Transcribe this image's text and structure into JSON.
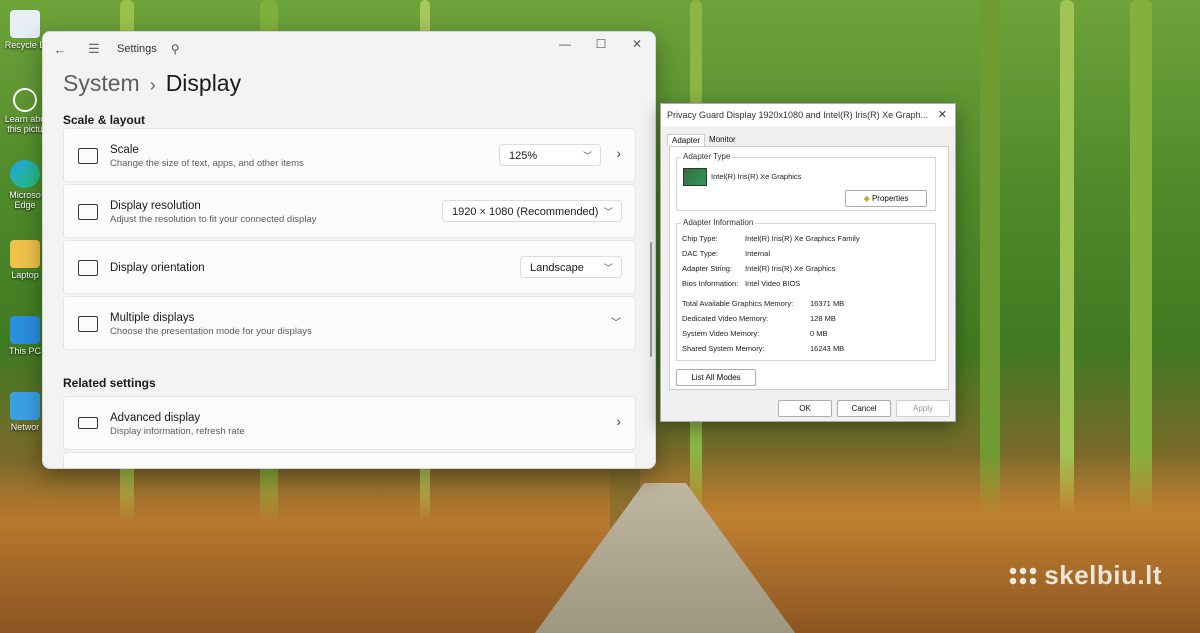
{
  "desktop": {
    "icons": [
      {
        "label": "Recycle B",
        "icon": "recycle-bin-icon"
      },
      {
        "label": "Learn abo this pictu",
        "icon": "camera-icon"
      },
      {
        "label": "Microso Edge",
        "icon": "edge-icon"
      },
      {
        "label": "Laptop",
        "icon": "folder-user-icon"
      },
      {
        "label": "This PC",
        "icon": "monitor-icon"
      },
      {
        "label": "Networ",
        "icon": "network-icon"
      }
    ],
    "watermark": "skelbiu.lt"
  },
  "settings": {
    "app_title": "Settings",
    "breadcrumb_root": "System",
    "breadcrumb_current": "Display",
    "section_scale_layout": "Scale & layout",
    "scale": {
      "title": "Scale",
      "subtitle": "Change the size of text, apps, and other items",
      "value": "125%"
    },
    "resolution": {
      "title": "Display resolution",
      "subtitle": "Adjust the resolution to fit your connected display",
      "value": "1920 × 1080 (Recommended)"
    },
    "orientation": {
      "title": "Display orientation",
      "value": "Landscape"
    },
    "multiple": {
      "title": "Multiple displays",
      "subtitle": "Choose the presentation mode for your displays"
    },
    "section_related": "Related settings",
    "advanced": {
      "title": "Advanced display",
      "subtitle": "Display information, refresh rate"
    }
  },
  "dialog": {
    "title": "Privacy Guard Display 1920x1080 and Intel(R) Iris(R) Xe Graph...",
    "tabs": [
      "Adapter",
      "Monitor"
    ],
    "adapter_type_label": "Adapter Type",
    "adapter_name": "Intel(R) Iris(R) Xe Graphics",
    "properties_label": "Properties",
    "adapter_info_label": "Adapter Information",
    "info": [
      {
        "k": "Chip Type:",
        "v": "Intel(R) Iris(R) Xe Graphics Family"
      },
      {
        "k": "DAC Type:",
        "v": "Internal"
      },
      {
        "k": "Adapter String:",
        "v": "Intel(R) Iris(R) Xe Graphics"
      },
      {
        "k": "Bios Information:",
        "v": "Intel Video BIOS"
      }
    ],
    "memory": [
      {
        "k": "Total Available Graphics Memory:",
        "v": "16371 MB"
      },
      {
        "k": "Dedicated Video Memory:",
        "v": "128 MB"
      },
      {
        "k": "System Video Memory:",
        "v": "0 MB"
      },
      {
        "k": "Shared System Memory:",
        "v": "16243 MB"
      }
    ],
    "list_all_modes": "List All Modes",
    "ok": "OK",
    "cancel": "Cancel",
    "apply": "Apply"
  }
}
